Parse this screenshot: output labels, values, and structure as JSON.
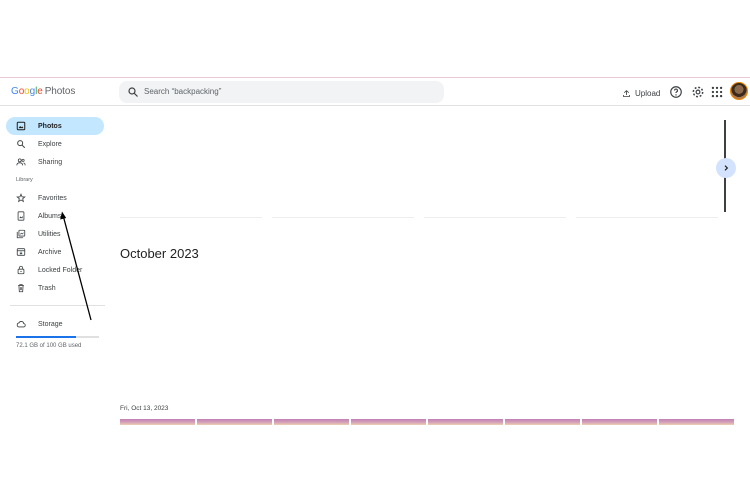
{
  "app": {
    "logo_google_letters": [
      "G",
      "o",
      "o",
      "g",
      "l",
      "e"
    ],
    "logo_product": "Photos"
  },
  "search": {
    "placeholder": "Search “backpacking”"
  },
  "toolbar": {
    "upload_label": "Upload",
    "icons": [
      "upload-icon",
      "help-icon",
      "settings-icon",
      "apps-icon"
    ]
  },
  "sidebar": {
    "items": [
      {
        "label": "Photos",
        "icon": "photo-icon",
        "active": true
      },
      {
        "label": "Explore",
        "icon": "search-icon"
      },
      {
        "label": "Sharing",
        "icon": "people-icon"
      }
    ],
    "library_heading": "Library",
    "library_items": [
      {
        "label": "Favorites",
        "icon": "star-icon"
      },
      {
        "label": "Albums",
        "icon": "album-icon"
      },
      {
        "label": "Utilities",
        "icon": "utilities-icon"
      },
      {
        "label": "Archive",
        "icon": "archive-icon"
      },
      {
        "label": "Locked Folder",
        "icon": "lock-icon"
      },
      {
        "label": "Trash",
        "icon": "trash-icon"
      }
    ],
    "storage": {
      "label": "Storage",
      "used_text": "72.1 GB of 100 GB used",
      "used_fraction": 0.721
    }
  },
  "main": {
    "month_heading": "October 2023",
    "day_heading": "Fri, Oct 13, 2023",
    "thumbnail_count": 8
  },
  "colors": {
    "accent": "#1a73e8",
    "active_nav": "#c2e7ff",
    "search_bg": "#f1f3f4"
  }
}
